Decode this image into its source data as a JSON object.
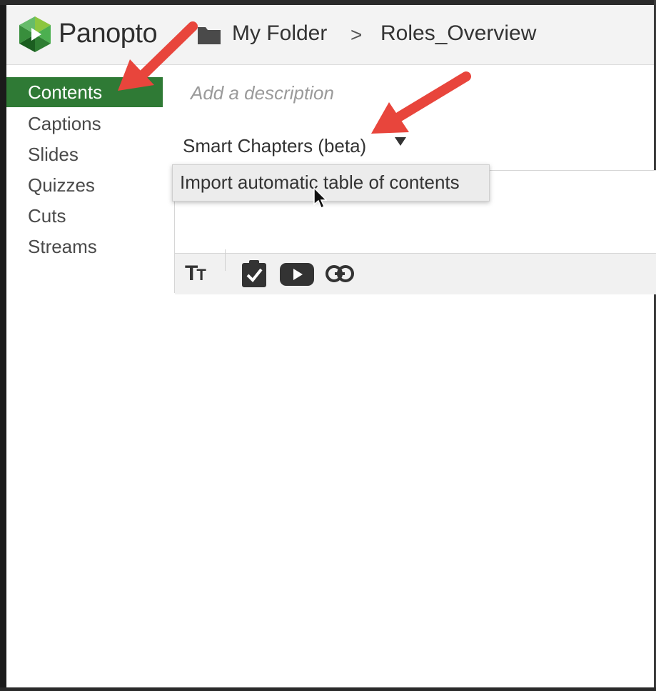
{
  "header": {
    "logo_text": "Panopto",
    "breadcrumb_folder": "My Folder",
    "breadcrumb_separator": ">",
    "breadcrumb_session": "Roles_Overview"
  },
  "sidebar": {
    "items": [
      {
        "label": "Contents",
        "active": true
      },
      {
        "label": "Captions",
        "active": false
      },
      {
        "label": "Slides",
        "active": false
      },
      {
        "label": "Quizzes",
        "active": false
      },
      {
        "label": "Cuts",
        "active": false
      },
      {
        "label": "Streams",
        "active": false
      }
    ]
  },
  "main": {
    "description_placeholder": "Add a description",
    "chapters_dropdown": "Smart Chapters (beta)",
    "menu_item": "Import automatic table of contents",
    "toolbar": {
      "text_size_icon": "text-size-icon",
      "icons": [
        "text-size-icon",
        "clipboard-check-icon",
        "youtube-icon",
        "link-icon"
      ]
    }
  },
  "colors": {
    "accent_green": "#2f7a35",
    "annotation_red": "#e8453c",
    "header_bg": "#f3f3f3"
  }
}
